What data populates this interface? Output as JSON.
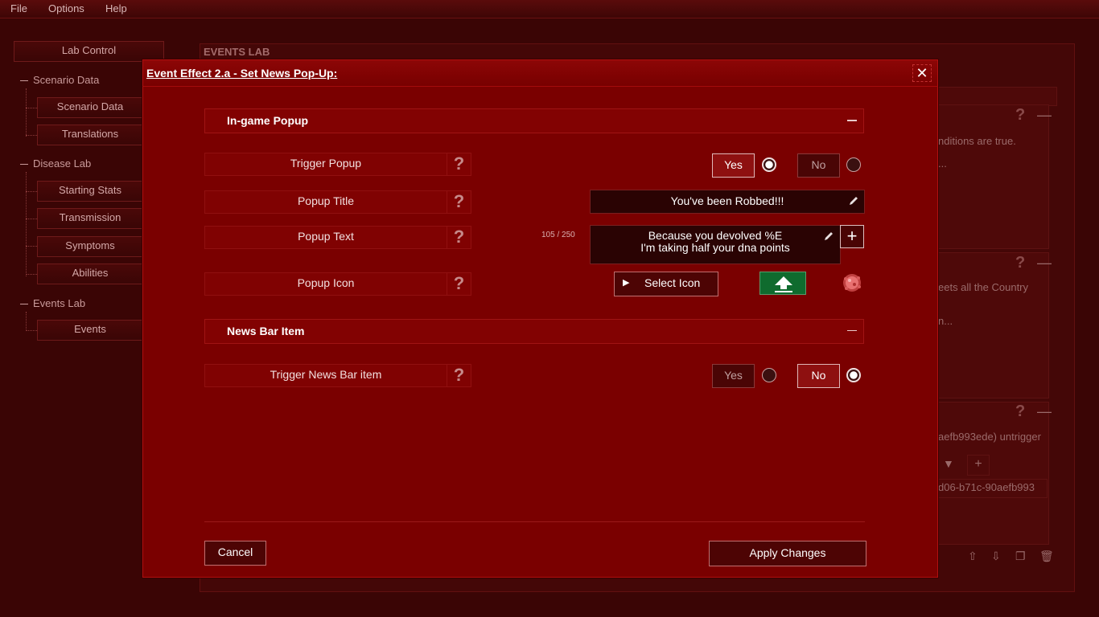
{
  "menu": {
    "file": "File",
    "options": "Options",
    "help": "Help"
  },
  "sidebar": {
    "lab_control": "Lab Control",
    "scenario_data": "Scenario Data",
    "scenario_data_item": "Scenario Data",
    "translations": "Translations",
    "disease_lab": "Disease Lab",
    "starting_stats": "Starting Stats",
    "transmission": "Transmission",
    "symptoms": "Symptoms",
    "abilities": "Abilities",
    "events_lab": "Events Lab",
    "events": "Events"
  },
  "background": {
    "panel_title": "EVENTS LAB",
    "text1": "nditions are true.",
    "text1b": "...",
    "text2": "eets all the Country",
    "text2b": "n...",
    "text3": "aefb993ede) untrigger",
    "text4": "d06-b71c-90aefb993"
  },
  "dialog": {
    "title": "Event Effect 2.a - Set News Pop-Up:",
    "sections": {
      "popup": "In-game Popup",
      "newsbar": "News Bar Item"
    },
    "rows": {
      "trigger_popup": "Trigger Popup",
      "popup_title": "Popup Title",
      "popup_text": "Popup Text",
      "popup_icon": "Popup Icon",
      "trigger_newsbar": "Trigger News Bar item"
    },
    "help_glyph": "?",
    "trigger_popup": {
      "yes": "Yes",
      "no": "No",
      "selected": "Yes"
    },
    "trigger_newsbar": {
      "yes": "Yes",
      "no": "No",
      "selected": "No"
    },
    "popup_title_value": "You've been Robbed!!!",
    "popup_text_line1": "Because you devolved %E",
    "popup_text_line2": "I'm taking half your dna points",
    "char_count": "105 / 250",
    "select_icon": "Select Icon",
    "cancel": "Cancel",
    "apply": "Apply Changes"
  },
  "colors": {
    "dialog_bg": "#7a0000",
    "upload_green": "#0f6b2e"
  }
}
